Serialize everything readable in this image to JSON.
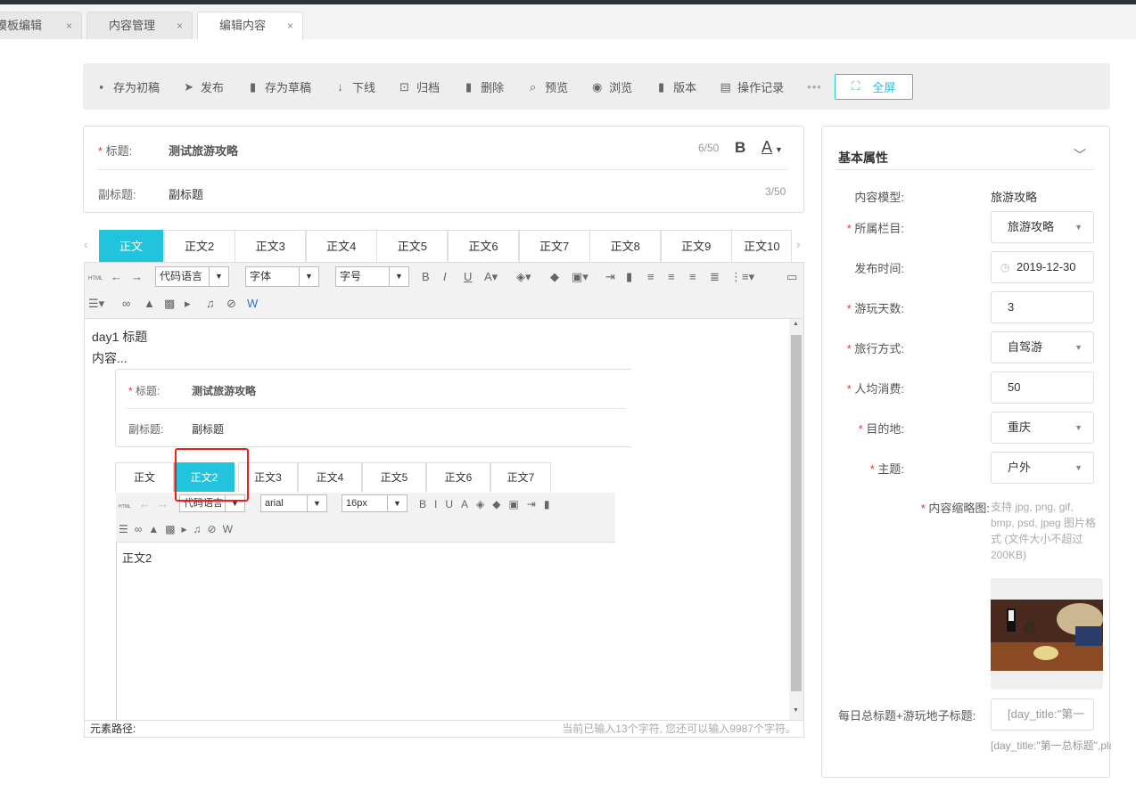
{
  "page_tabs": [
    {
      "label": "模板编辑"
    },
    {
      "label": "内容管理"
    },
    {
      "label": "编辑内容"
    }
  ],
  "tab_close": "×",
  "toolbar": {
    "items": [
      {
        "label": "存为初稿",
        "icon": "save-icon",
        "glyph": "▪"
      },
      {
        "label": "发布",
        "icon": "send-icon",
        "glyph": "➤"
      },
      {
        "label": "存为草稿",
        "icon": "draft-icon",
        "glyph": "▮"
      },
      {
        "label": "下线",
        "icon": "arrow-down-icon",
        "glyph": "↓"
      },
      {
        "label": "归档",
        "icon": "archive-icon",
        "glyph": "⊡"
      },
      {
        "label": "删除",
        "icon": "trash-icon",
        "glyph": "▮"
      },
      {
        "label": "预览",
        "icon": "preview-icon",
        "glyph": "⌕"
      },
      {
        "label": "浏览",
        "icon": "eye-icon",
        "glyph": "◉"
      },
      {
        "label": "版本",
        "icon": "bookmark-icon",
        "glyph": "▮"
      },
      {
        "label": "操作记录",
        "icon": "log-icon",
        "glyph": "▤"
      }
    ],
    "more": "•••",
    "fullscreen": "全屏"
  },
  "title_card": {
    "title_label": "标题:",
    "title_value": "测试旅游攻略",
    "title_count": "6/50",
    "bold": "B",
    "color": "A",
    "subtitle_label": "副标题:",
    "subtitle_value": "副标题",
    "subtitle_count": "3/50"
  },
  "body_tabs": [
    "正文",
    "正文2",
    "正文3",
    "正文4",
    "正文5",
    "正文6",
    "正文7",
    "正文8",
    "正文9",
    "正文10"
  ],
  "editor": {
    "html": "HTML",
    "code_lang": "代码语言",
    "font": "字体",
    "size": "字号",
    "content_line1": "day1 标题",
    "content_line2": "内容...",
    "status_left": "元素路径:",
    "status_right": "当前已输入13个字符, 您还可以输入9987个字符。"
  },
  "nested": {
    "title_label": "标题:",
    "title_value": "测试旅游攻略",
    "subtitle_label": "副标题:",
    "subtitle_value": "副标题",
    "tabs": [
      "正文",
      "正文2",
      "正文3",
      "正文4",
      "正文5",
      "正文6",
      "正文7"
    ],
    "code_lang": "代码语言",
    "font": "arial",
    "size": "16px",
    "content": "正文2"
  },
  "side": {
    "title": "基本属性",
    "model_label": "内容模型:",
    "model_value": "旅游攻略",
    "fields": [
      {
        "label": "所属栏目:",
        "value": "旅游攻略",
        "required": true,
        "dropdown": true
      },
      {
        "label": "发布时间:",
        "value": "2019-12-30",
        "required": false,
        "dropdown": false,
        "clock": true
      },
      {
        "label": "游玩天数:",
        "value": "3",
        "required": true,
        "dropdown": false
      },
      {
        "label": "旅行方式:",
        "value": "自驾游",
        "required": true,
        "dropdown": true
      },
      {
        "label": "人均消费:",
        "value": "50",
        "required": true,
        "dropdown": false
      },
      {
        "label": "目的地:",
        "value": "重庆",
        "required": true,
        "dropdown": true
      },
      {
        "label": "主题:",
        "value": "户外",
        "required": true,
        "dropdown": true
      }
    ],
    "thumb_label": "内容缩略图:",
    "thumb_hint": "支持 jpg, png, gif, bmp, psd, jpeg 图片格式 (文件大小不超过200KB)",
    "daily_label": "每日总标题+游玩地子标题:",
    "daily_value": "[day_title:\"第一",
    "daily_hint": "[day_title:\"第一总标题\",place_ti"
  }
}
